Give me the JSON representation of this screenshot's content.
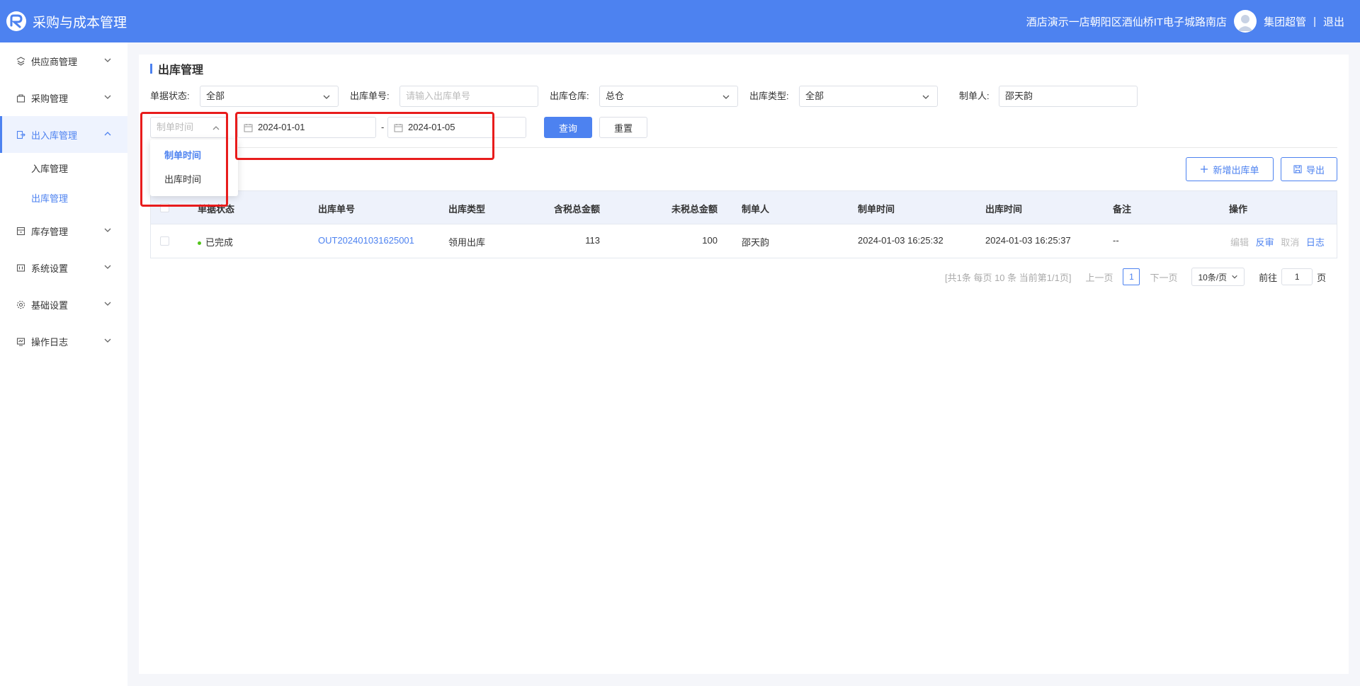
{
  "header": {
    "app_title": "采购与成本管理",
    "store_name": "酒店演示一店朝阳区酒仙桥IT电子城路南店",
    "user_name": "集团超管",
    "separator": "|",
    "logout": "退出"
  },
  "sidebar": {
    "items": [
      {
        "label": "供应商管理",
        "icon": "supplier-icon"
      },
      {
        "label": "采购管理",
        "icon": "purchase-icon"
      },
      {
        "label": "出入库管理",
        "icon": "inout-icon"
      },
      {
        "label": "库存管理",
        "icon": "inventory-icon"
      },
      {
        "label": "系统设置",
        "icon": "system-icon"
      },
      {
        "label": "基础设置",
        "icon": "gear-icon"
      },
      {
        "label": "操作日志",
        "icon": "log-icon"
      }
    ],
    "sub_items": [
      {
        "label": "入库管理"
      },
      {
        "label": "出库管理"
      }
    ]
  },
  "page": {
    "title": "出库管理"
  },
  "filters": {
    "status_label": "单据状态:",
    "status_value": "全部",
    "order_no_label": "出库单号:",
    "order_no_placeholder": "请输入出库单号",
    "warehouse_label": "出库仓库:",
    "warehouse_value": "总仓",
    "type_label": "出库类型:",
    "type_value": "全部",
    "creator_label": "制单人:",
    "creator_value": "邵天韵",
    "time_type_value": "制单时间",
    "date_start": "2024-01-01",
    "date_sep": "-",
    "date_end": "2024-01-05",
    "query_button": "查询",
    "reset_button": "重置"
  },
  "dropdown": {
    "options": [
      "制单时间",
      "出库时间"
    ]
  },
  "actions": {
    "add_button": "新增出库单",
    "export_button": "导出"
  },
  "table": {
    "columns": [
      "单据状态",
      "出库单号",
      "出库类型",
      "含税总金额",
      "未税总金额",
      "制单人",
      "制单时间",
      "出库时间",
      "备注",
      "操作"
    ],
    "rows": [
      {
        "status": "已完成",
        "order_no": "OUT202401031625001",
        "type": "领用出库",
        "tax_amount": "113",
        "notax_amount": "100",
        "creator": "邵天韵",
        "created_at": "2024-01-03 16:25:32",
        "out_at": "2024-01-03 16:25:37",
        "remark": "--",
        "ops": [
          "编辑",
          "反审",
          "取消",
          "日志"
        ]
      }
    ]
  },
  "pagination": {
    "summary": "[共1条 每页 10 条 当前第1/1页]",
    "prev": "上一页",
    "current": "1",
    "next": "下一页",
    "page_size": "10条/页",
    "goto_label": "前往",
    "goto_value": "1",
    "goto_suffix": "页"
  },
  "colors": {
    "primary": "#4d82f0",
    "highlight_border": "#e81c1c",
    "status_done": "#52c41a"
  }
}
